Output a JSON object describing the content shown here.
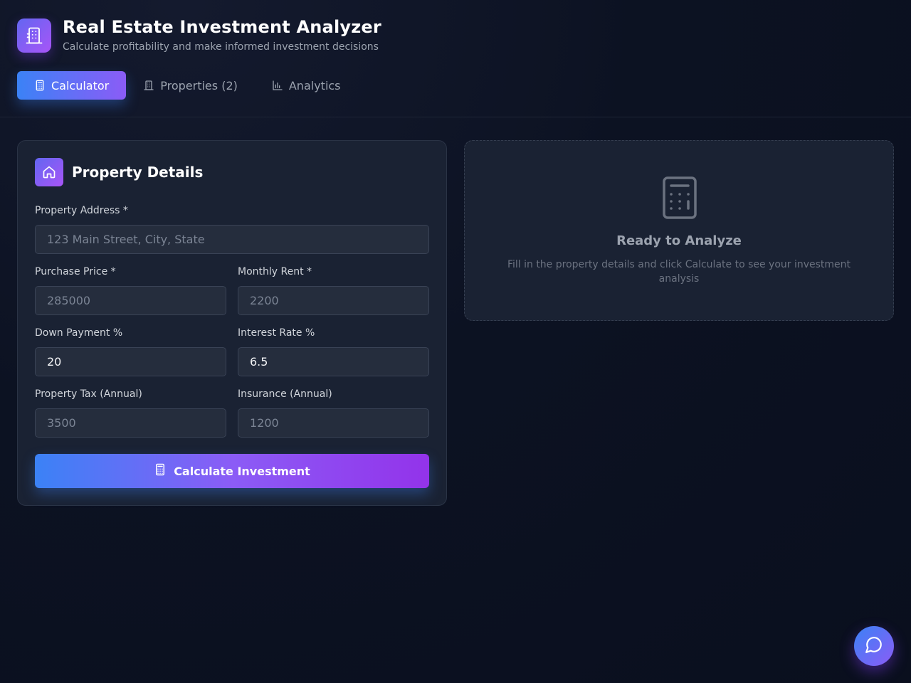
{
  "header": {
    "title": "Real Estate Investment Analyzer",
    "subtitle": "Calculate profitability and make informed investment decisions"
  },
  "tabs": [
    {
      "label": "Calculator",
      "icon": "calculator-icon",
      "active": true
    },
    {
      "label": "Properties (2)",
      "icon": "building-icon",
      "active": false
    },
    {
      "label": "Analytics",
      "icon": "bar-chart-icon",
      "active": false
    }
  ],
  "form": {
    "title": "Property Details",
    "address": {
      "label": "Property Address *",
      "placeholder": "123 Main Street, City, State",
      "value": ""
    },
    "purchase_price": {
      "label": "Purchase Price *",
      "placeholder": "285000",
      "value": ""
    },
    "monthly_rent": {
      "label": "Monthly Rent *",
      "placeholder": "2200",
      "value": ""
    },
    "down_payment": {
      "label": "Down Payment %",
      "placeholder": "",
      "value": "20"
    },
    "interest_rate": {
      "label": "Interest Rate %",
      "placeholder": "",
      "value": "6.5"
    },
    "property_tax": {
      "label": "Property Tax (Annual)",
      "placeholder": "3500",
      "value": ""
    },
    "insurance": {
      "label": "Insurance (Annual)",
      "placeholder": "1200",
      "value": ""
    },
    "submit_label": "Calculate Investment"
  },
  "ready": {
    "title": "Ready to Analyze",
    "text": "Fill in the property details and click Calculate to see your investment analysis"
  },
  "colors": {
    "accent_start": "#3b82f6",
    "accent_end": "#8b5cf6",
    "background": "#0c1222",
    "card": "#1a2233"
  }
}
